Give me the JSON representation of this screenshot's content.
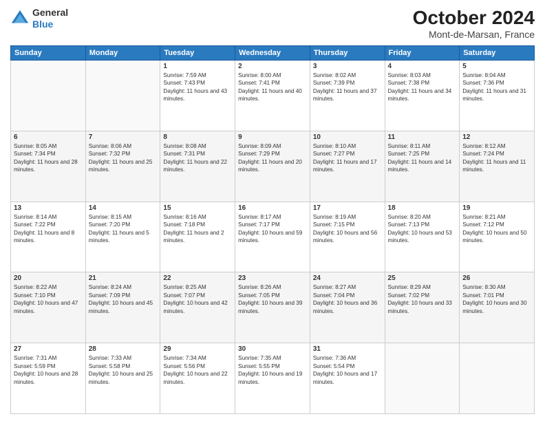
{
  "header": {
    "logo_line1": "General",
    "logo_line2": "Blue",
    "month_year": "October 2024",
    "location": "Mont-de-Marsan, France"
  },
  "days_of_week": [
    "Sunday",
    "Monday",
    "Tuesday",
    "Wednesday",
    "Thursday",
    "Friday",
    "Saturday"
  ],
  "weeks": [
    [
      {
        "day": "",
        "info": ""
      },
      {
        "day": "",
        "info": ""
      },
      {
        "day": "1",
        "info": "Sunrise: 7:59 AM\nSunset: 7:43 PM\nDaylight: 11 hours and 43 minutes."
      },
      {
        "day": "2",
        "info": "Sunrise: 8:00 AM\nSunset: 7:41 PM\nDaylight: 11 hours and 40 minutes."
      },
      {
        "day": "3",
        "info": "Sunrise: 8:02 AM\nSunset: 7:39 PM\nDaylight: 11 hours and 37 minutes."
      },
      {
        "day": "4",
        "info": "Sunrise: 8:03 AM\nSunset: 7:38 PM\nDaylight: 11 hours and 34 minutes."
      },
      {
        "day": "5",
        "info": "Sunrise: 8:04 AM\nSunset: 7:36 PM\nDaylight: 11 hours and 31 minutes."
      }
    ],
    [
      {
        "day": "6",
        "info": "Sunrise: 8:05 AM\nSunset: 7:34 PM\nDaylight: 11 hours and 28 minutes."
      },
      {
        "day": "7",
        "info": "Sunrise: 8:06 AM\nSunset: 7:32 PM\nDaylight: 11 hours and 25 minutes."
      },
      {
        "day": "8",
        "info": "Sunrise: 8:08 AM\nSunset: 7:31 PM\nDaylight: 11 hours and 22 minutes."
      },
      {
        "day": "9",
        "info": "Sunrise: 8:09 AM\nSunset: 7:29 PM\nDaylight: 11 hours and 20 minutes."
      },
      {
        "day": "10",
        "info": "Sunrise: 8:10 AM\nSunset: 7:27 PM\nDaylight: 11 hours and 17 minutes."
      },
      {
        "day": "11",
        "info": "Sunrise: 8:11 AM\nSunset: 7:25 PM\nDaylight: 11 hours and 14 minutes."
      },
      {
        "day": "12",
        "info": "Sunrise: 8:12 AM\nSunset: 7:24 PM\nDaylight: 11 hours and 11 minutes."
      }
    ],
    [
      {
        "day": "13",
        "info": "Sunrise: 8:14 AM\nSunset: 7:22 PM\nDaylight: 11 hours and 8 minutes."
      },
      {
        "day": "14",
        "info": "Sunrise: 8:15 AM\nSunset: 7:20 PM\nDaylight: 11 hours and 5 minutes."
      },
      {
        "day": "15",
        "info": "Sunrise: 8:16 AM\nSunset: 7:18 PM\nDaylight: 11 hours and 2 minutes."
      },
      {
        "day": "16",
        "info": "Sunrise: 8:17 AM\nSunset: 7:17 PM\nDaylight: 10 hours and 59 minutes."
      },
      {
        "day": "17",
        "info": "Sunrise: 8:19 AM\nSunset: 7:15 PM\nDaylight: 10 hours and 56 minutes."
      },
      {
        "day": "18",
        "info": "Sunrise: 8:20 AM\nSunset: 7:13 PM\nDaylight: 10 hours and 53 minutes."
      },
      {
        "day": "19",
        "info": "Sunrise: 8:21 AM\nSunset: 7:12 PM\nDaylight: 10 hours and 50 minutes."
      }
    ],
    [
      {
        "day": "20",
        "info": "Sunrise: 8:22 AM\nSunset: 7:10 PM\nDaylight: 10 hours and 47 minutes."
      },
      {
        "day": "21",
        "info": "Sunrise: 8:24 AM\nSunset: 7:09 PM\nDaylight: 10 hours and 45 minutes."
      },
      {
        "day": "22",
        "info": "Sunrise: 8:25 AM\nSunset: 7:07 PM\nDaylight: 10 hours and 42 minutes."
      },
      {
        "day": "23",
        "info": "Sunrise: 8:26 AM\nSunset: 7:05 PM\nDaylight: 10 hours and 39 minutes."
      },
      {
        "day": "24",
        "info": "Sunrise: 8:27 AM\nSunset: 7:04 PM\nDaylight: 10 hours and 36 minutes."
      },
      {
        "day": "25",
        "info": "Sunrise: 8:29 AM\nSunset: 7:02 PM\nDaylight: 10 hours and 33 minutes."
      },
      {
        "day": "26",
        "info": "Sunrise: 8:30 AM\nSunset: 7:01 PM\nDaylight: 10 hours and 30 minutes."
      }
    ],
    [
      {
        "day": "27",
        "info": "Sunrise: 7:31 AM\nSunset: 5:59 PM\nDaylight: 10 hours and 28 minutes."
      },
      {
        "day": "28",
        "info": "Sunrise: 7:33 AM\nSunset: 5:58 PM\nDaylight: 10 hours and 25 minutes."
      },
      {
        "day": "29",
        "info": "Sunrise: 7:34 AM\nSunset: 5:56 PM\nDaylight: 10 hours and 22 minutes."
      },
      {
        "day": "30",
        "info": "Sunrise: 7:35 AM\nSunset: 5:55 PM\nDaylight: 10 hours and 19 minutes."
      },
      {
        "day": "31",
        "info": "Sunrise: 7:36 AM\nSunset: 5:54 PM\nDaylight: 10 hours and 17 minutes."
      },
      {
        "day": "",
        "info": ""
      },
      {
        "day": "",
        "info": ""
      }
    ]
  ]
}
